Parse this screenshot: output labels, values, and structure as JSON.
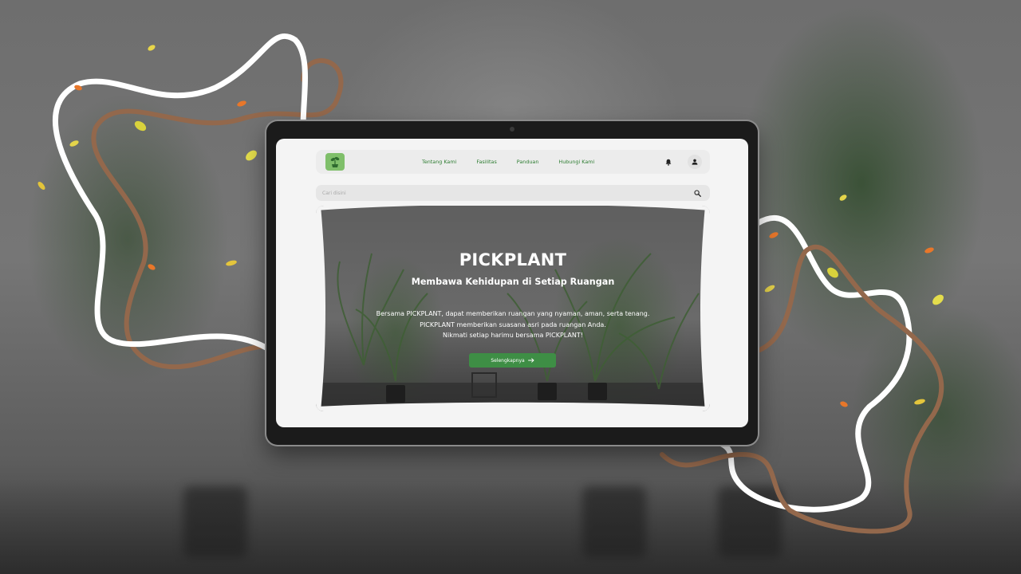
{
  "nav": {
    "links": [
      "Tentang Kami",
      "Fasilitas",
      "Panduan",
      "Hubungi Kami"
    ]
  },
  "search": {
    "placeholder": "Cari disini"
  },
  "hero": {
    "title": "PICKPLANT",
    "subtitle": "Membawa Kehidupan di Setiap Ruangan",
    "description": [
      "Bersama PICKPLANT, dapat memberikan ruangan yang nyaman, aman, serta tenang.",
      "PICKPLANT memberikan suasana asri pada ruangan Anda.",
      "Nikmati setiap harimu bersama PICKPLANT!"
    ],
    "cta_label": "Selengkapnya"
  },
  "icons": {
    "logo": "plant-logo-icon",
    "bell": "bell-icon",
    "user": "user-icon",
    "search": "search-icon",
    "cta_arrow": "arrow-right-icon"
  },
  "colors": {
    "brand_green": "#3e8e45",
    "nav_link": "#2e7d32",
    "logo_bg": "#7fbf6a",
    "swirl_white": "#ffffff",
    "swirl_brown": "#93684c"
  }
}
